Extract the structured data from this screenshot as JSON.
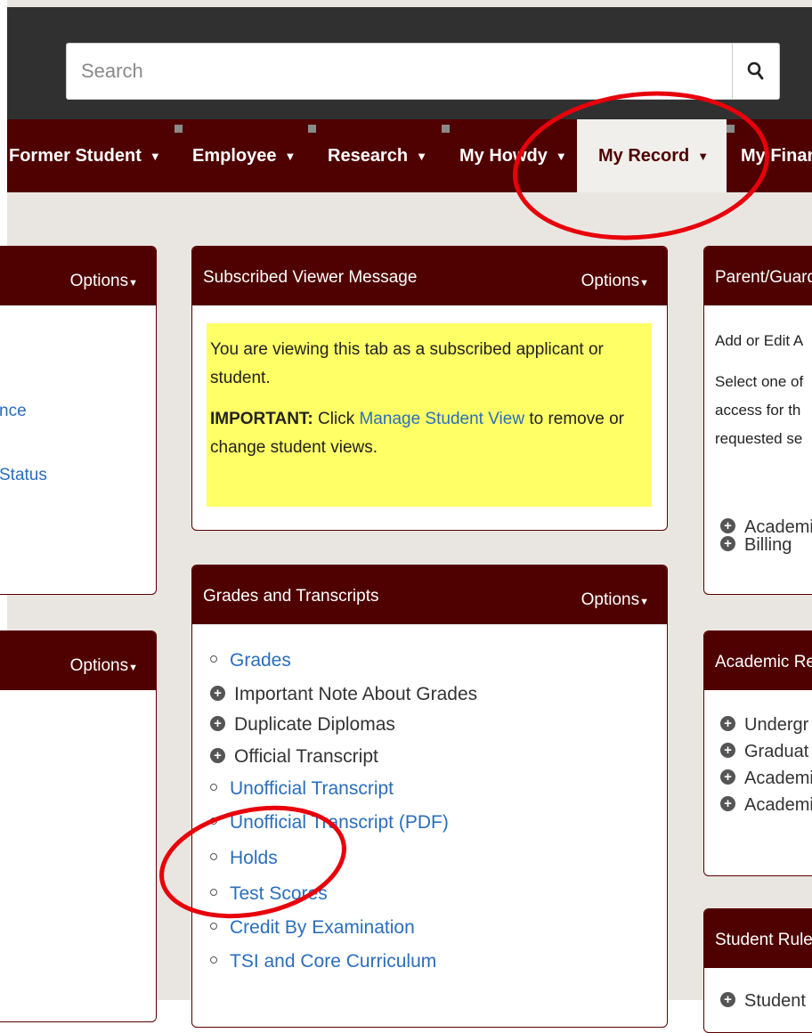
{
  "search": {
    "placeholder": "Search"
  },
  "nav": {
    "items": [
      {
        "label": "Former Student",
        "caret": "▼"
      },
      {
        "label": "Employee",
        "caret": "▼"
      },
      {
        "label": "Research",
        "caret": "▼"
      },
      {
        "label": "My Howdy",
        "caret": "▼"
      },
      {
        "label": "My Record",
        "caret": "▼"
      },
      {
        "label": "My Finan",
        "caret": ""
      }
    ]
  },
  "left_panel_1": {
    "options": "Options",
    "links": [
      "nce",
      "Status"
    ]
  },
  "left_panel_2": {
    "options": "Options"
  },
  "viewer_message": {
    "title": "Subscribed Viewer Message",
    "options": "Options",
    "line1": "You are viewing this tab as a subscribed applicant or student.",
    "important_label": "IMPORTANT:",
    "click_text": " Click ",
    "manage_link": "Manage Student View",
    "after_link": " to remove or change student views."
  },
  "grades_panel": {
    "title": "Grades and Transcripts",
    "options": "Options",
    "items": [
      {
        "type": "link",
        "label": "Grades"
      },
      {
        "type": "expand",
        "label": "Important Note About Grades"
      },
      {
        "type": "expand",
        "label": "Duplicate Diplomas"
      },
      {
        "type": "expand",
        "label": "Official Transcript"
      },
      {
        "type": "link",
        "label": "Unofficial Transcript"
      },
      {
        "type": "link",
        "label": "Unofficial Transcript (PDF)"
      },
      {
        "type": "link",
        "label": "Holds"
      },
      {
        "type": "link",
        "label": "Test Scores"
      },
      {
        "type": "link",
        "label": "Credit By Examination"
      },
      {
        "type": "link",
        "label": "TSI and Core Curriculum"
      }
    ]
  },
  "parent_panel": {
    "title": "Parent/Guard",
    "line1": "Add or Edit A",
    "line2": "Select one of",
    "line3": "access for th",
    "line4": "requested se",
    "items": [
      "Academi",
      "Billing"
    ]
  },
  "academic_panel": {
    "title": "Academic Re",
    "items": [
      "Undergr",
      "Graduat",
      "Academi",
      "Academi"
    ]
  },
  "rules_panel": {
    "title": "Student Rules",
    "items": [
      "Student"
    ]
  },
  "colors": {
    "maroon": "#4f0000",
    "link": "#2a6ebb",
    "highlight": "#ffff66",
    "annotation": "#e8000b"
  }
}
